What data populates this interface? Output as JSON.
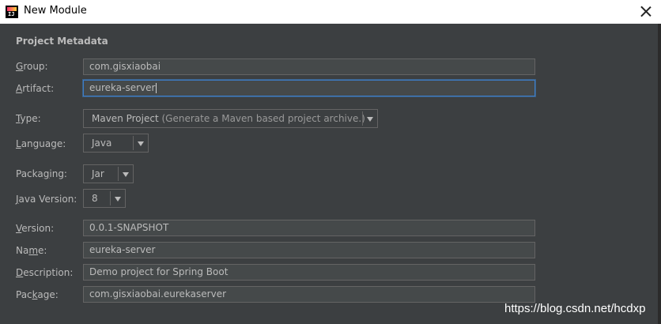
{
  "window": {
    "title": "New Module"
  },
  "section": {
    "title": "Project Metadata"
  },
  "fields": {
    "group": {
      "label_u": "G",
      "label_rest": "roup:",
      "value": "com.gisxiaobai"
    },
    "artifact": {
      "label_u": "A",
      "label_rest": "rtifact:",
      "value": "eureka-server"
    },
    "type": {
      "label_u": "T",
      "label_rest": "ype:",
      "value": "Maven Project",
      "hint": "(Generate a Maven based project archive.)"
    },
    "language": {
      "label_u": "L",
      "label_rest": "anguage:",
      "value": "Java"
    },
    "packaging": {
      "label_pre": "Packa",
      "label_u": "g",
      "label_rest": "ing:",
      "value": "Jar"
    },
    "java_version": {
      "label_u": "J",
      "label_rest": "ava Version:",
      "value": "8"
    },
    "version": {
      "label_u": "V",
      "label_rest": "ersion:",
      "value": "0.0.1-SNAPSHOT"
    },
    "name": {
      "label_pre": "Na",
      "label_u": "m",
      "label_rest": "e:",
      "value": "eureka-server"
    },
    "description": {
      "label_u": "D",
      "label_rest": "escription:",
      "value": "Demo project for Spring Boot"
    },
    "package": {
      "label_pre": "Pac",
      "label_u": "k",
      "label_rest": "age:",
      "value": "com.gisxiaobai.eurekaserver"
    }
  },
  "watermark": "https://blog.csdn.net/hcdxp",
  "icons": {
    "app": "intellij-idea-icon",
    "close": "close-icon",
    "dropdown": "chevron-down-icon"
  }
}
